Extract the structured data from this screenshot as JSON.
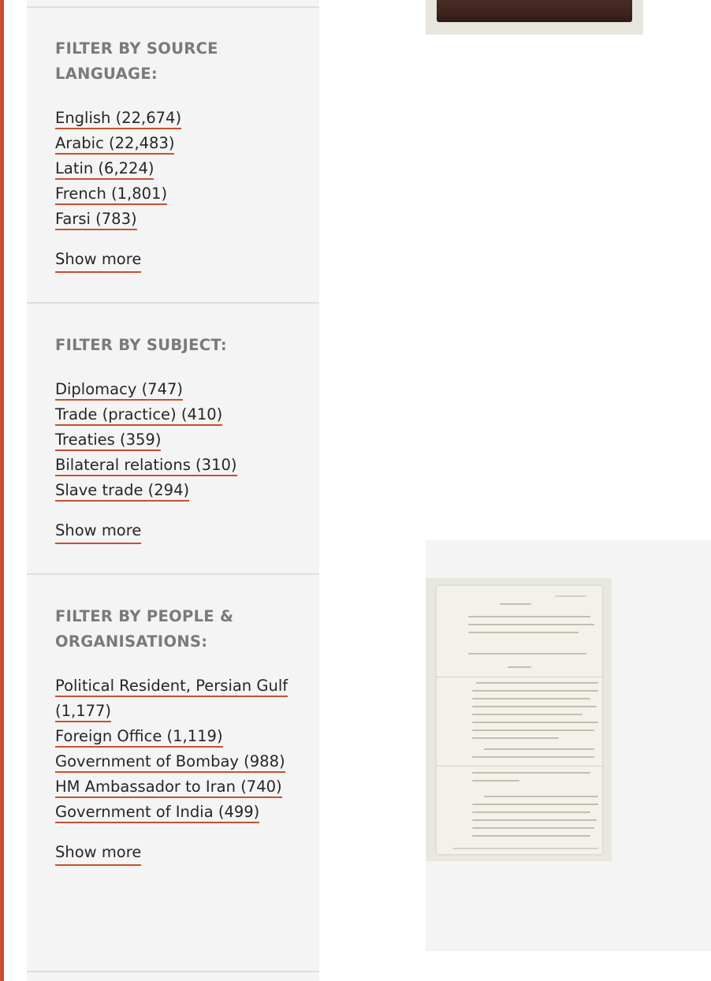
{
  "sidebar": {
    "sections": [
      {
        "heading": "FILTER BY SOURCE LANGUAGE:",
        "items": [
          {
            "label": "English (22,674)"
          },
          {
            "label": "Arabic (22,483)"
          },
          {
            "label": "Latin (6,224)"
          },
          {
            "label": "French (1,801)"
          },
          {
            "label": "Farsi (783)"
          }
        ],
        "show_more": "Show more"
      },
      {
        "heading": "FILTER BY SUBJECT:",
        "items": [
          {
            "label": "Diplomacy (747)"
          },
          {
            "label": "Trade (practice) (410)"
          },
          {
            "label": "Treaties (359)"
          },
          {
            "label": "Bilateral relations (310)"
          },
          {
            "label": "Slave trade (294)"
          }
        ],
        "show_more": "Show more"
      },
      {
        "heading": "FILTER BY PEOPLE & ORGANISATIONS:",
        "items": [
          {
            "label": "Political Resident, Persian Gulf (1,177)"
          },
          {
            "label": "Foreign Office (1,119)"
          },
          {
            "label": "Government of Bombay (988)"
          },
          {
            "label": "HM Ambassador to Iran (740)"
          },
          {
            "label": "Government of India (499)"
          }
        ],
        "show_more": "Show more"
      }
    ]
  },
  "colors": {
    "accent": "#c8502f",
    "heading_text": "#7a7a7a",
    "link_text": "#262626",
    "sidebar_bg": "#f4f4f4"
  }
}
